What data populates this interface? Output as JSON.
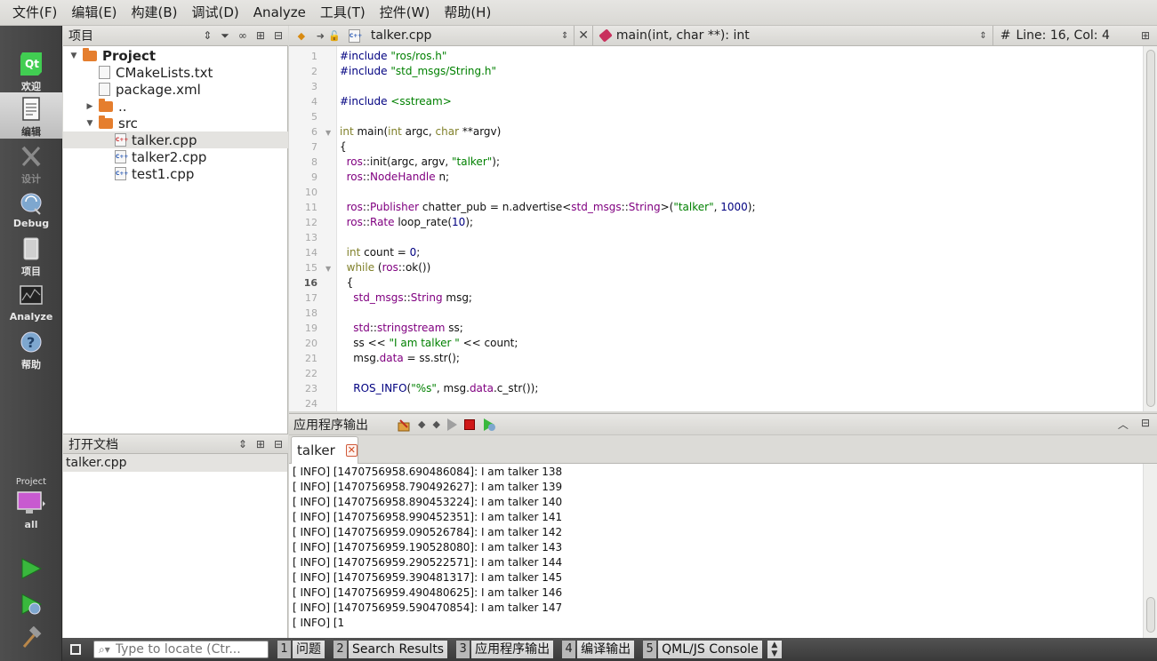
{
  "menubar": {
    "items": [
      "文件(F)",
      "编辑(E)",
      "构建(B)",
      "调试(D)",
      "Analyze",
      "工具(T)",
      "控件(W)",
      "帮助(H)"
    ]
  },
  "modes": {
    "welcome": "欢迎",
    "edit": "编辑",
    "design": "设计",
    "debug": "Debug",
    "projects": "项目",
    "analyze": "Analyze",
    "help": "帮助",
    "kit_label": "Project",
    "kit_config": "all"
  },
  "project_pane": {
    "title": "项目",
    "tree": [
      {
        "label": "Project",
        "kind": "folder",
        "expanded": true,
        "bold": true
      },
      {
        "label": "CMakeLists.txt",
        "kind": "file"
      },
      {
        "label": "package.xml",
        "kind": "file"
      },
      {
        "label": "..",
        "kind": "folder",
        "expanded": false
      },
      {
        "label": "src",
        "kind": "folder",
        "expanded": true
      },
      {
        "label": "talker.cpp",
        "kind": "cpp",
        "selected": true
      },
      {
        "label": "talker2.cpp",
        "kind": "cpp"
      },
      {
        "label": "test1.cpp",
        "kind": "cpp"
      }
    ]
  },
  "open_docs": {
    "title": "打开文档",
    "items": [
      "talker.cpp"
    ]
  },
  "editor_toolbar": {
    "file": "talker.cpp",
    "symbol": "main(int, char **): int",
    "hash": "#",
    "line_col": "Line: 16, Col: 4"
  },
  "editor": {
    "current_line": 16,
    "line_numbers": [
      "1",
      "2",
      "3",
      "4",
      "5",
      "6",
      "7",
      "8",
      "9",
      "10",
      "11",
      "12",
      "13",
      "14",
      "15",
      "16",
      "17",
      "18",
      "19",
      "20",
      "21",
      "22",
      "23",
      "24"
    ],
    "code": {
      "l1a": "#include ",
      "l1b": "\"ros/ros.h\"",
      "l2a": "#include ",
      "l2b": "\"std_msgs/String.h\"",
      "l4a": "#include ",
      "l4b": "<sstream>",
      "l6a": "int",
      "l6b": " main(",
      "l6c": "int",
      "l6d": " argc, ",
      "l6e": "char",
      "l6f": " **argv)",
      "l7": "{",
      "l8a": "  ros",
      "l8b": "::init(argc, argv, ",
      "l8c": "\"talker\"",
      "l8d": ");",
      "l9a": "  ros",
      "l9b": "::",
      "l9c": "NodeHandle",
      "l9d": " n;",
      "l11a": "  ros",
      "l11b": "::",
      "l11c": "Publisher",
      "l11d": " chatter_pub = n.advertise<",
      "l11e": "std_msgs",
      "l11f": "::",
      "l11g": "String",
      "l11h": ">(",
      "l11i": "\"talker\"",
      "l11j": ", ",
      "l11k": "1000",
      "l11l": ");",
      "l12a": "  ros",
      "l12b": "::",
      "l12c": "Rate",
      "l12d": " loop_rate(",
      "l12e": "10",
      "l12f": ");",
      "l14a": "  int",
      "l14b": " count = ",
      "l14c": "0",
      "l14d": ";",
      "l15a": "  while",
      "l15b": " (",
      "l15c": "ros",
      "l15d": "::ok())",
      "l16": "  {",
      "l17a": "    std_msgs",
      "l17b": "::",
      "l17c": "String",
      "l17d": " msg;",
      "l19a": "    std",
      "l19b": "::",
      "l19c": "stringstream",
      "l19d": " ss;",
      "l20a": "    ss << ",
      "l20b": "\"I am talker \"",
      "l20c": " << count;",
      "l21a": "    msg.",
      "l21b": "data",
      "l21c": " = ss.str();",
      "l23a": "    ",
      "l23b": "ROS_INFO",
      "l23c": "(",
      "l23d": "\"%s\"",
      "l23e": ", msg.",
      "l23f": "data",
      "l23g": ".c_str());"
    }
  },
  "output": {
    "title": "应用程序输出",
    "tab": "talker",
    "lines": [
      "[ INFO] [1470756958.690486084]: I am talker 138",
      "[ INFO] [1470756958.790492627]: I am talker 139",
      "[ INFO] [1470756958.890453224]: I am talker 140",
      "[ INFO] [1470756958.990452351]: I am talker 141",
      "[ INFO] [1470756959.090526784]: I am talker 142",
      "[ INFO] [1470756959.190528080]: I am talker 143",
      "[ INFO] [1470756959.290522571]: I am talker 144",
      "[ INFO] [1470756959.390481317]: I am talker 145",
      "[ INFO] [1470756959.490480625]: I am talker 146",
      "[ INFO] [1470756959.590470854]: I am talker 147",
      "[ INFO] [1"
    ]
  },
  "statusbar": {
    "locator_placeholder": "Type to locate (Ctr...",
    "panes": [
      {
        "num": "1",
        "label": "问题"
      },
      {
        "num": "2",
        "label": "Search Results"
      },
      {
        "num": "3",
        "label": "应用程序输出"
      },
      {
        "num": "4",
        "label": "编译输出"
      },
      {
        "num": "5",
        "label": "QML/JS Console"
      }
    ]
  },
  "colors": {
    "keyword": "#80802a",
    "type": "#800080",
    "string": "#008000",
    "number": "#000080",
    "folder": "#e57e2e"
  }
}
